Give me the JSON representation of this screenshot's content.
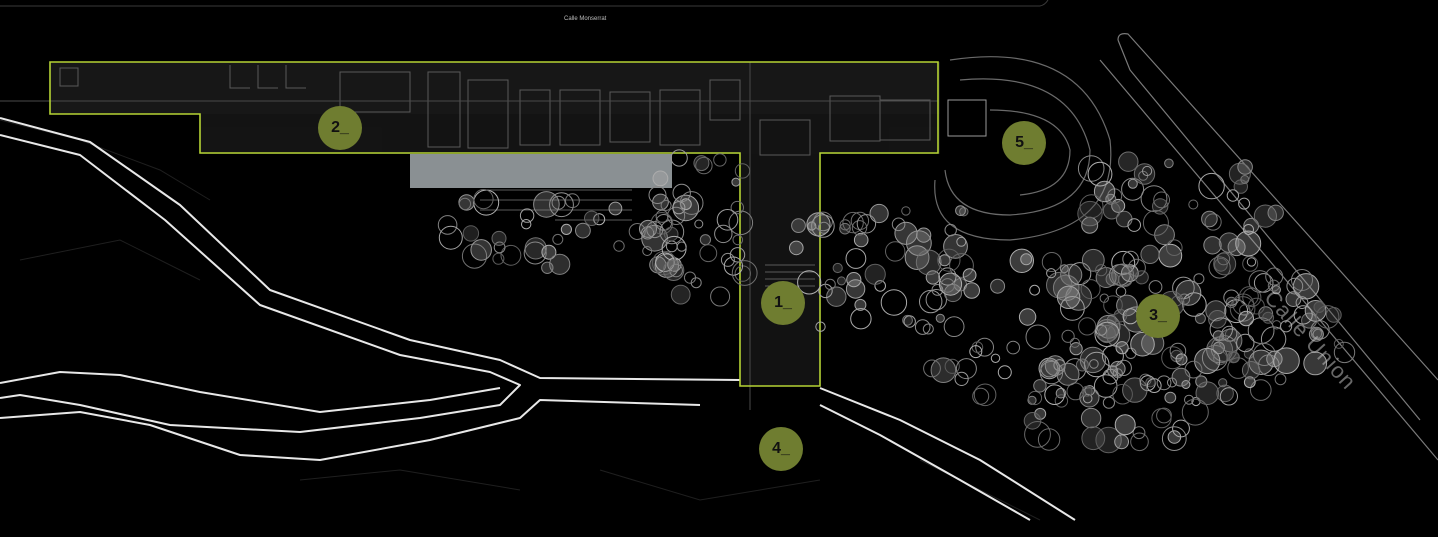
{
  "map": {
    "street_top": "Calle Monserrat",
    "street_right": "Calle Union",
    "accent_color": "#b5d334",
    "marker_color": "#6f7d30"
  },
  "markers": [
    {
      "label": "1_"
    },
    {
      "label": "2_"
    },
    {
      "label": "3_"
    },
    {
      "label": "4_"
    },
    {
      "label": "5_"
    }
  ]
}
